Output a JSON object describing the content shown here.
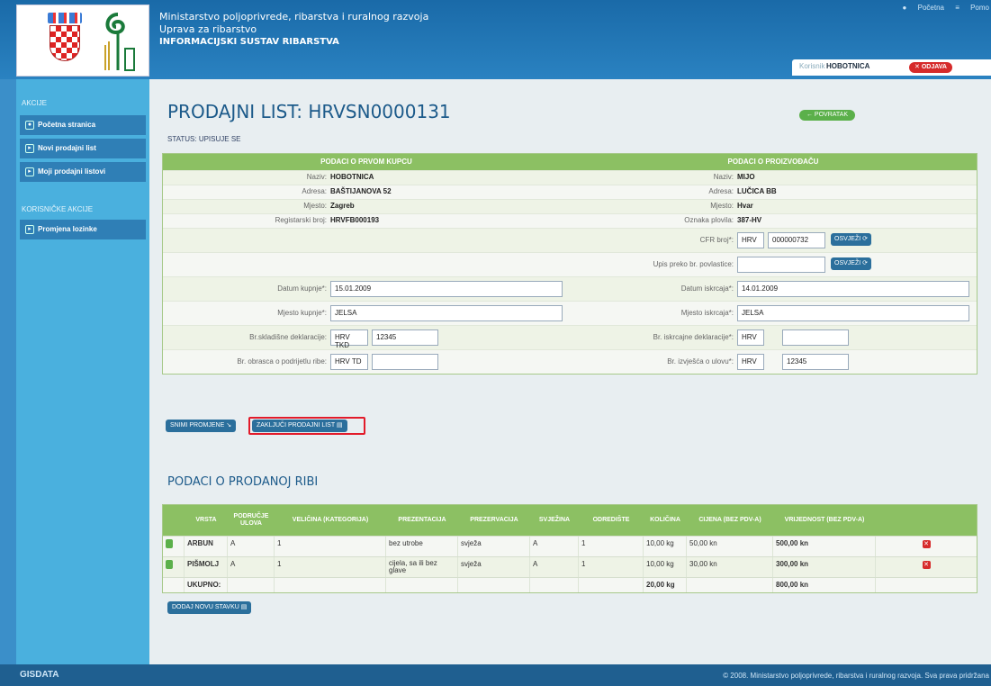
{
  "header": {
    "org_line1": "Ministarstvo poljoprivrede, ribarstva i ruralnog razvoja",
    "org_line2": "Uprava za ribarstvo",
    "org_line3": "INFORMACIJSKI SUSTAV RIBARSTVA",
    "link_home": "Početna",
    "link_help": "Pomo",
    "user_label": "Korisnik",
    "user_name": "HOBOTNICA",
    "logout": "ODJAVA"
  },
  "sidebar": {
    "section1": "AKCIJE",
    "items": [
      {
        "label": "Početna stranica"
      },
      {
        "label": "Novi prodajni list"
      },
      {
        "label": "Moji prodajni listovi"
      }
    ],
    "section2": "KORISNIČKE AKCIJE",
    "items2": [
      {
        "label": "Promjena lozinke"
      }
    ]
  },
  "main": {
    "title": "PRODAJNI LIST: HRVSN0000131",
    "status": "STATUS: UPISUJE SE",
    "back": "POVRATAK"
  },
  "form": {
    "buyer_header": "PODACI O PRVOM KUPCU",
    "producer_header": "PODACI O PROIZVOĐAČU",
    "naziv_label": "Naziv:",
    "buyer_naziv": "HOBOTNICA",
    "producer_naziv": "MIJO",
    "adresa_label": "Adresa:",
    "buyer_adresa": "BAŠTIJANOVA 52",
    "producer_adresa": "LUČICA BB",
    "mjesto_label": "Mjesto:",
    "buyer_mjesto": "Zagreb",
    "producer_mjesto": "Hvar",
    "reg_label": "Registarski broj:",
    "reg_value": "HRVFB000193",
    "oznaka_label": "Oznaka plovila:",
    "oznaka_value": "387-HV",
    "cfr_label": "CFR broj*:",
    "cfr_prefix": "HRV",
    "cfr_value": "000000732",
    "refresh": "OSVJEŽI",
    "upis_label": "Upis preko br. povlastice:",
    "upis_value": "",
    "datum_kupnje_label": "Datum kupnje*:",
    "datum_kupnje": "15.01.2009",
    "datum_iskrcaja_label": "Datum iskrcaja*:",
    "datum_iskrcaja": "14.01.2009",
    "mjesto_kupnje_label": "Mjesto kupnje*:",
    "mjesto_kupnje": "JELSA",
    "mjesto_iskrcaja_label": "Mjesto iskrcaja*:",
    "mjesto_iskrcaja": "JELSA",
    "skladisne_label": "Br.skladišne deklaracije:",
    "skladisne_prefix": "HRV TKD",
    "skladisne_value": "12345",
    "iskrcajne_label": "Br. iskrcajne deklaracije*:",
    "iskrcajne_prefix": "HRV",
    "iskrcajne_value": "",
    "obrasca_label": "Br. obrasca o podrijetlu ribe:",
    "obrasca_prefix": "HRV TD",
    "obrasca_value": "",
    "izvjesca_label": "Br. izvješća o ulovu*:",
    "izvjesca_prefix": "HRV",
    "izvjesca_value": "12345",
    "save_btn": "SNIMI PROMJENE",
    "finish_btn": "ZAKLJUČI PRODAJNI LIST"
  },
  "fish": {
    "title": "PODACI O PRODANOJ RIBI",
    "headers": [
      "VRSTA",
      "PODRUČJE ULOVA",
      "VELIČINA (KATEGORIJA)",
      "PREZENTACIJA",
      "PREZERVACIJA",
      "SVJEŽINA",
      "ODREDIŠTE",
      "KOLIČINA",
      "CIJENA (BEZ PDV-A)",
      "VRIJEDNOST (BEZ PDV-A)"
    ],
    "rows": [
      {
        "vrsta": "ARBUN",
        "podrucje": "A",
        "velicina": "1",
        "prezentacija": "bez utrobe",
        "prezervacija": "svježa",
        "svjezina": "A",
        "odrediste": "1",
        "kolicina": "10,00 kg",
        "cijena": "50,00 kn",
        "vrijednost": "500,00 kn"
      },
      {
        "vrsta": "PIŠMOLJ",
        "podrucje": "A",
        "velicina": "1",
        "prezentacija": "cijela, sa ili bez glave",
        "prezervacija": "svježa",
        "svjezina": "A",
        "odrediste": "1",
        "kolicina": "10,00 kg",
        "cijena": "30,00 kn",
        "vrijednost": "300,00 kn"
      }
    ],
    "total_label": "UKUPNO:",
    "total_kolicina": "20,00 kg",
    "total_vrijednost": "800,00 kn",
    "add_btn": "DODAJ NOVU STAVKU"
  },
  "footer": {
    "brand": "GISDATA",
    "copyright": "© 2008. Ministarstvo poljoprivrede, ribarstva i ruralnog razvoja. Sva prava pridržana"
  }
}
